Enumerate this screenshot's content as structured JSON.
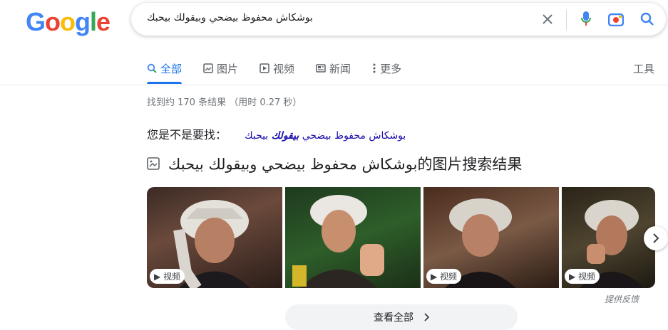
{
  "logo": {
    "letters": [
      "G",
      "o",
      "o",
      "g",
      "l",
      "e"
    ],
    "colors": [
      "#4285F4",
      "#EA4335",
      "#FBBC05",
      "#4285F4",
      "#34A853",
      "#EA4335"
    ]
  },
  "search": {
    "query": "بوشكاش محفوظ بيضحي وبيقولك بيحبك"
  },
  "tabs": [
    {
      "label": "全部",
      "icon": "search-icon"
    },
    {
      "label": "图片",
      "icon": "image-icon"
    },
    {
      "label": "视频",
      "icon": "play-icon"
    },
    {
      "label": "新闻",
      "icon": "news-icon"
    },
    {
      "label": "更多",
      "icon": "more-vert-icon"
    }
  ],
  "tools_label": "工具",
  "result_stats": "找到约 170 条结果 （用时 0.27 秒）",
  "did_you_mean": {
    "prefix": "您是不是要找：",
    "before": "بوشكاش محفوظ بيضحي ",
    "bold": "بيقولك",
    "after": " بيحبك"
  },
  "images_heading": "بوشكاش محفوظ بيضحي وبيقولك بيحبك的图片搜索结果",
  "thumbnails": [
    {
      "badge": "▶ 视频"
    },
    {
      "badge": ""
    },
    {
      "badge": "▶ 视频"
    },
    {
      "badge": "▶ 视频"
    }
  ],
  "feedback": "提供反馈",
  "see_all": "查看全部",
  "colors": {
    "accent": "#1a73e8",
    "link": "#1a0dab"
  }
}
